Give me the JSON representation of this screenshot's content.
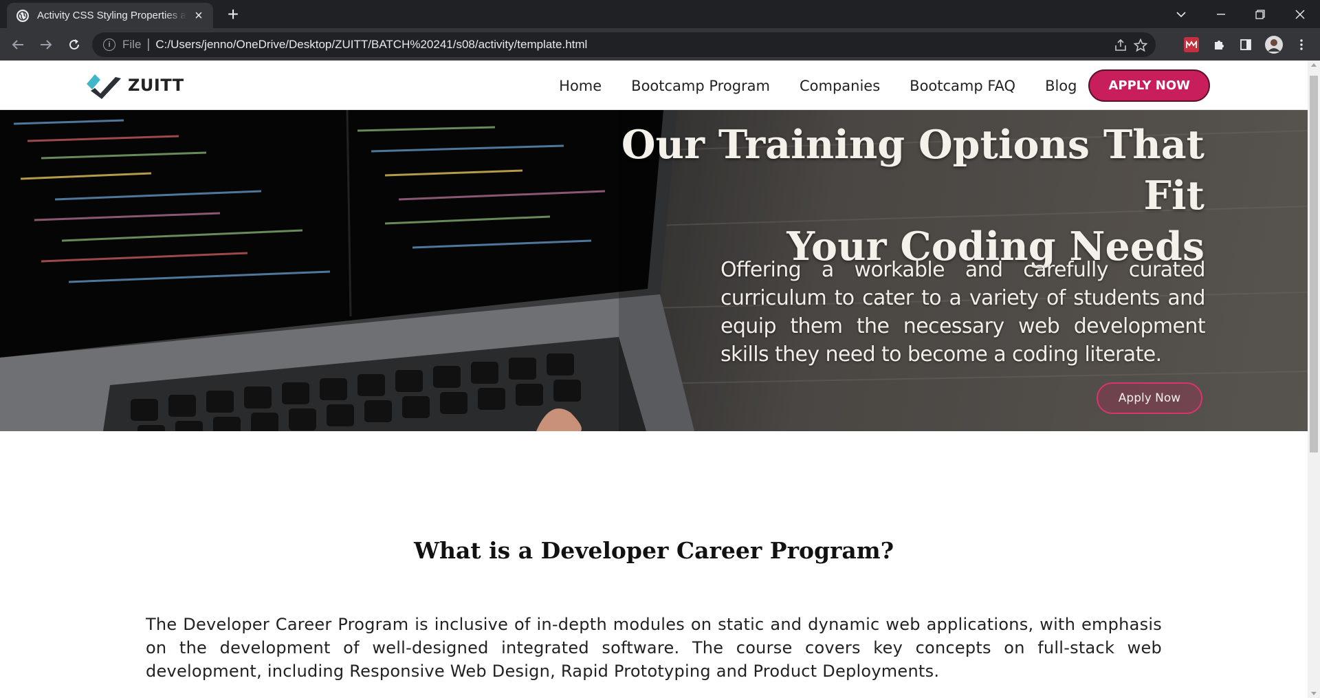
{
  "browser": {
    "tab_title": "Activity CSS Styling Properties and",
    "omnibox_scheme": "File",
    "url": "C:/Users/jenno/OneDrive/Desktop/ZUITT/BATCH%20241/s08/activity/template.html",
    "chrome_bg": "#202124",
    "toolbar_bg": "#35363a"
  },
  "site": {
    "logo_text": "ZUITT",
    "nav": [
      "Home",
      "Bootcamp Program",
      "Companies",
      "Bootcamp FAQ",
      "Blog"
    ],
    "apply_label": "APPLY NOW",
    "accent": "#c81e5b"
  },
  "hero": {
    "title_line1": "Our Training Options That Fit",
    "title_line2": "Your Coding Needs",
    "description": "Offering a workable and carefully curated curriculum to cater to a variety of students and equip them the necessary web development skills they need to become a coding literate.",
    "button_label": "Apply Now"
  },
  "section": {
    "title": "What is a Developer Career Program?",
    "body": "The Developer Career Program is inclusive of in-depth modules on static and dynamic web applications, with emphasis on the development of well-designed integrated software. The course covers key concepts on full-stack web development, including Responsive Web Design, Rapid Prototyping and Product Deployments."
  }
}
